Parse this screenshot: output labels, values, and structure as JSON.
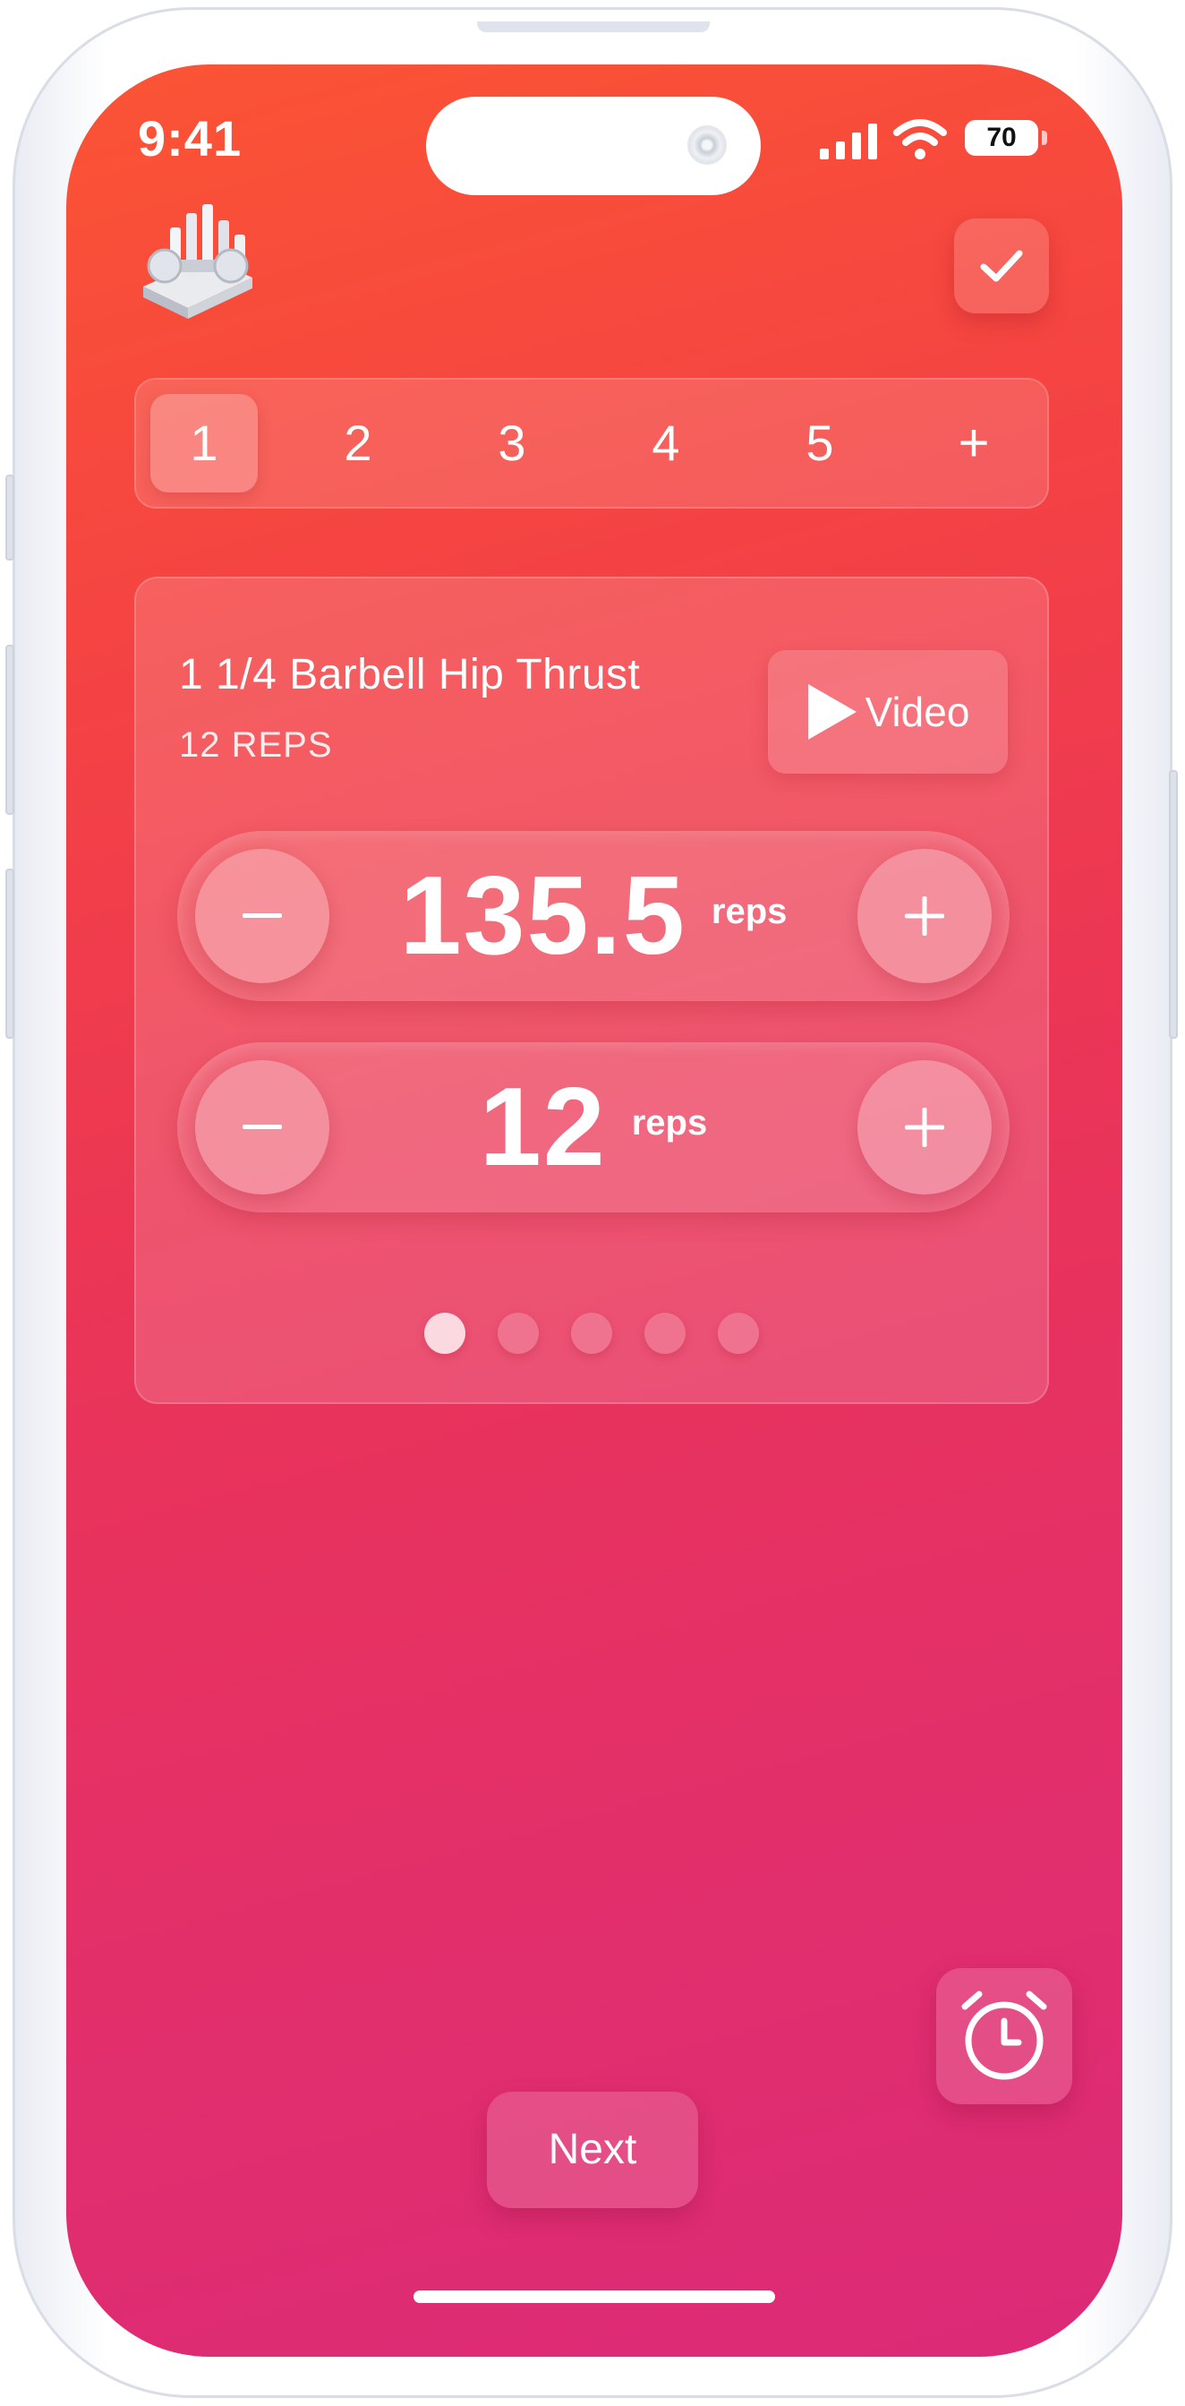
{
  "status_bar": {
    "time": "9:41",
    "battery": "70"
  },
  "sets": {
    "tabs": [
      "1",
      "2",
      "3",
      "4",
      "5"
    ],
    "add_label": "+",
    "active_index": 0
  },
  "exercise": {
    "name": "1 1/4 Barbell Hip Thrust",
    "target": "12 REPS",
    "video_label": "Video"
  },
  "weight_stepper": {
    "value": "135.5",
    "unit": "reps"
  },
  "reps_stepper": {
    "value": "12",
    "unit": "reps"
  },
  "pagination": {
    "count": 5,
    "active_index": 0
  },
  "footer": {
    "next_label": "Next"
  },
  "colors": {
    "gradient_top": "#fb5434",
    "gradient_mid": "#ea3458",
    "gradient_bottom": "#dc2a78",
    "text": "#ffffff"
  },
  "icons": {
    "logo": "dumbbell-rack-icon",
    "check": "checkmark-icon",
    "video": "play-icon",
    "minus": "minus-icon",
    "plus": "plus-icon",
    "timer": "alarm-clock-icon"
  }
}
